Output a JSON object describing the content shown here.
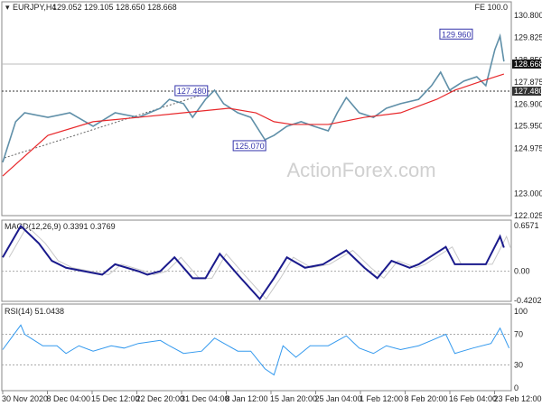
{
  "header": {
    "symbol": "EURJPY,H4",
    "ohlc": "129.052 129.105 128.650 128.668",
    "fe": "FE 100.0"
  },
  "watermark": "ActionForex.com",
  "chart_data": [
    {
      "type": "line",
      "title": "EURJPY,H4",
      "ylim": [
        122.025,
        130.8
      ],
      "yticks": [
        "130.800",
        "129.825",
        "128.850",
        "127.875",
        "126.900",
        "125.950",
        "124.975",
        "123.000",
        "122.025"
      ],
      "ytick_values": [
        130.8,
        129.825,
        128.85,
        127.875,
        126.9,
        125.95,
        124.975,
        123.0,
        122.025
      ],
      "current_price": "128.668",
      "current_value": 128.668,
      "level": "127.480",
      "level_value": 127.48,
      "annotations": [
        {
          "text": "129.960",
          "bar": 365,
          "value": 129.96
        },
        {
          "text": "127.480",
          "bar": 160,
          "value": 127.48
        },
        {
          "text": "125.070",
          "bar": 205,
          "value": 125.07
        }
      ],
      "series": [
        {
          "name": "price",
          "color": "#5f8fa8",
          "bars": [
            0,
            10,
            17,
            35,
            52,
            70,
            87,
            105,
            122,
            129,
            140,
            147,
            157,
            164,
            171,
            182,
            192,
            203,
            210,
            220,
            231,
            241,
            252,
            259,
            266,
            276,
            287,
            297,
            308,
            322,
            332,
            339,
            346,
            357,
            367,
            374,
            381,
            385,
            388
          ],
          "values": [
            124.36,
            126.14,
            126.53,
            126.33,
            126.53,
            125.94,
            126.53,
            126.33,
            126.73,
            127.12,
            126.93,
            126.33,
            127.12,
            127.52,
            126.93,
            126.53,
            126.33,
            125.35,
            125.54,
            125.94,
            126.14,
            125.94,
            125.74,
            126.53,
            127.2,
            126.53,
            126.33,
            126.73,
            126.93,
            127.12,
            127.72,
            128.31,
            127.52,
            127.92,
            128.11,
            127.72,
            129.3,
            129.89,
            128.78
          ]
        },
        {
          "name": "MA",
          "color": "#e8282b",
          "bars": [
            0,
            35,
            70,
            105,
            140,
            175,
            196,
            210,
            224,
            252,
            280,
            308,
            336,
            350,
            371,
            388
          ],
          "values": [
            123.76,
            125.54,
            126.14,
            126.33,
            126.53,
            126.73,
            126.53,
            126.14,
            126.02,
            126.02,
            126.33,
            126.53,
            127.12,
            127.52,
            127.92,
            128.23
          ]
        }
      ]
    },
    {
      "type": "line",
      "title": "MACD(12,26,9) 0.3391 0.3769",
      "ylim": [
        -0.4202,
        0.6571
      ],
      "yticks": [
        "0.6571",
        "0.00",
        "-0.4202"
      ],
      "series": [
        {
          "name": "MACD",
          "color": "#1a1a8c",
          "bars": [
            0,
            14,
            28,
            38,
            49,
            63,
            77,
            87,
            105,
            112,
            122,
            133,
            147,
            157,
            168,
            182,
            199,
            210,
            220,
            234,
            248,
            266,
            280,
            290,
            301,
            315,
            322,
            343,
            350,
            364,
            374,
            385,
            388
          ],
          "values": [
            0.2,
            0.65,
            0.4,
            0.15,
            0.05,
            0.0,
            -0.05,
            0.1,
            0.0,
            -0.05,
            0.0,
            0.2,
            -0.1,
            -0.1,
            0.25,
            -0.05,
            -0.4,
            -0.1,
            0.2,
            0.05,
            0.1,
            0.3,
            0.05,
            -0.1,
            0.15,
            0.05,
            0.1,
            0.35,
            0.1,
            0.1,
            0.1,
            0.5,
            0.34
          ]
        }
      ]
    },
    {
      "type": "line",
      "title": "RSI(14) 51.0438",
      "ylim": [
        0,
        100
      ],
      "yticks": [
        "100",
        "70",
        "30",
        "0"
      ],
      "series": [
        {
          "name": "RSI",
          "color": "#3399ee",
          "bars": [
            0,
            14,
            17,
            31,
            42,
            49,
            59,
            70,
            84,
            94,
            105,
            122,
            129,
            140,
            154,
            164,
            182,
            192,
            203,
            210,
            217,
            227,
            238,
            252,
            266,
            276,
            287,
            297,
            308,
            322,
            332,
            343,
            350,
            364,
            378,
            385,
            392
          ],
          "values": [
            50,
            82,
            70,
            55,
            55,
            45,
            55,
            48,
            55,
            52,
            58,
            62,
            55,
            45,
            48,
            65,
            48,
            48,
            25,
            17,
            55,
            40,
            55,
            55,
            68,
            52,
            45,
            55,
            50,
            55,
            62,
            70,
            45,
            52,
            58,
            78,
            52
          ]
        }
      ]
    }
  ],
  "xticks": [
    "30 Nov 2020",
    "8 Dec 04:00",
    "15 Dec 12:00",
    "22 Dec 20:00",
    "31 Dec 04:00",
    "8 Jan 12:00",
    "15 Jan 20:00",
    "25 Jan 04:00",
    "1 Feb 12:00",
    "8 Feb 20:00",
    "16 Feb 04:00",
    "23 Feb 12:00"
  ]
}
